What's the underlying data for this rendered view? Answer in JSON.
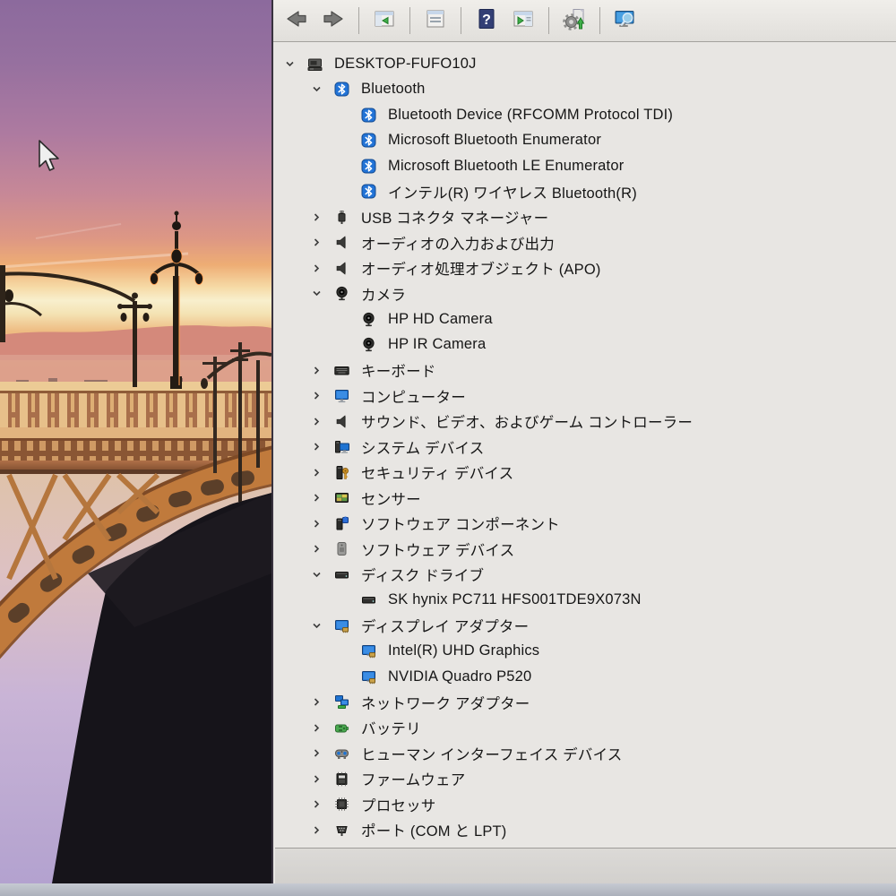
{
  "window": {
    "app": "Device Manager (MMC)",
    "computer_name": "DESKTOP-FUFO10J"
  },
  "colors": {
    "panel_bg": "#e8e6e3",
    "bluetooth_blue": "#2273d6",
    "monitor_blue": "#1e73d2",
    "battery_green": "#49a94f",
    "help_blue": "#333f75",
    "bezel_gray": "#b7bcc6"
  },
  "toolbar": {
    "buttons": [
      {
        "name": "back",
        "icon": "back-arrow",
        "sep_before": false
      },
      {
        "name": "forward",
        "icon": "forward-arrow",
        "sep_before": false
      },
      {
        "name": "show-console-tree",
        "icon": "console-tree-window",
        "sep_before": true
      },
      {
        "name": "properties",
        "icon": "properties-window",
        "sep_before": true
      },
      {
        "name": "help",
        "icon": "help",
        "sep_before": true
      },
      {
        "name": "show-action-pane",
        "icon": "action-pane-window",
        "sep_before": false
      },
      {
        "name": "scan-hardware-changes",
        "icon": "scan-hardware",
        "sep_before": true
      },
      {
        "name": "search-computer",
        "icon": "computer-search",
        "sep_before": true
      }
    ]
  },
  "tree": {
    "items": [
      {
        "label": "DESKTOP-FUFO10J",
        "level": 0,
        "chevron": "expanded",
        "icon": "computer-host"
      },
      {
        "label": "Bluetooth",
        "level": 1,
        "chevron": "expanded",
        "icon": "bluetooth"
      },
      {
        "label": "Bluetooth Device (RFCOMM Protocol TDI)",
        "level": 2,
        "chevron": "none",
        "icon": "bluetooth"
      },
      {
        "label": "Microsoft Bluetooth Enumerator",
        "level": 2,
        "chevron": "none",
        "icon": "bluetooth"
      },
      {
        "label": "Microsoft Bluetooth LE Enumerator",
        "level": 2,
        "chevron": "none",
        "icon": "bluetooth"
      },
      {
        "label": "インテル(R) ワイヤレス Bluetooth(R)",
        "level": 2,
        "chevron": "none",
        "icon": "bluetooth"
      },
      {
        "label": "USB コネクタ マネージャー",
        "level": 1,
        "chevron": "collapsed",
        "icon": "usb"
      },
      {
        "label": "オーディオの入力および出力",
        "level": 1,
        "chevron": "collapsed",
        "icon": "audio"
      },
      {
        "label": "オーディオ処理オブジェクト (APO)",
        "level": 1,
        "chevron": "collapsed",
        "icon": "audio"
      },
      {
        "label": "カメラ",
        "level": 1,
        "chevron": "expanded",
        "icon": "camera"
      },
      {
        "label": "HP HD Camera",
        "level": 2,
        "chevron": "none",
        "icon": "camera"
      },
      {
        "label": "HP IR Camera",
        "level": 2,
        "chevron": "none",
        "icon": "camera"
      },
      {
        "label": "キーボード",
        "level": 1,
        "chevron": "collapsed",
        "icon": "keyboard"
      },
      {
        "label": "コンピューター",
        "level": 1,
        "chevron": "collapsed",
        "icon": "monitor"
      },
      {
        "label": "サウンド、ビデオ、およびゲーム コントローラー",
        "level": 1,
        "chevron": "collapsed",
        "icon": "audio"
      },
      {
        "label": "システム デバイス",
        "level": 1,
        "chevron": "collapsed",
        "icon": "system"
      },
      {
        "label": "セキュリティ デバイス",
        "level": 1,
        "chevron": "collapsed",
        "icon": "security"
      },
      {
        "label": "センサー",
        "level": 1,
        "chevron": "collapsed",
        "icon": "sensor"
      },
      {
        "label": "ソフトウェア コンポーネント",
        "level": 1,
        "chevron": "collapsed",
        "icon": "software-component"
      },
      {
        "label": "ソフトウェア デバイス",
        "level": 1,
        "chevron": "collapsed",
        "icon": "software-device"
      },
      {
        "label": "ディスク ドライブ",
        "level": 1,
        "chevron": "expanded",
        "icon": "disk"
      },
      {
        "label": "SK hynix PC711 HFS001TDE9X073N",
        "level": 2,
        "chevron": "none",
        "icon": "disk"
      },
      {
        "label": "ディスプレイ アダプター",
        "level": 1,
        "chevron": "expanded",
        "icon": "display"
      },
      {
        "label": "Intel(R) UHD Graphics",
        "level": 2,
        "chevron": "none",
        "icon": "display"
      },
      {
        "label": "NVIDIA Quadro P520",
        "level": 2,
        "chevron": "none",
        "icon": "display"
      },
      {
        "label": "ネットワーク アダプター",
        "level": 1,
        "chevron": "collapsed",
        "icon": "network"
      },
      {
        "label": "バッテリ",
        "level": 1,
        "chevron": "collapsed",
        "icon": "battery"
      },
      {
        "label": "ヒューマン インターフェイス デバイス",
        "level": 1,
        "chevron": "collapsed",
        "icon": "hid"
      },
      {
        "label": "ファームウェア",
        "level": 1,
        "chevron": "collapsed",
        "icon": "firmware"
      },
      {
        "label": "プロセッサ",
        "level": 1,
        "chevron": "collapsed",
        "icon": "processor"
      },
      {
        "label": "ポート (COM と LPT)",
        "level": 1,
        "chevron": "collapsed",
        "icon": "port"
      },
      {
        "label": "",
        "level": 1,
        "chevron": "collapsed",
        "icon": "generic-device",
        "partial": true
      }
    ]
  }
}
